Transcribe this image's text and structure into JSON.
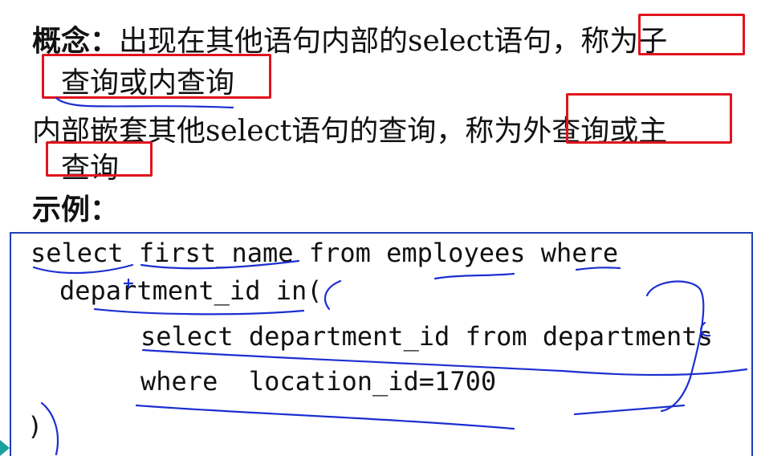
{
  "slide": {
    "concept_label": "概念：",
    "concept_text_a": "出现在其他语句内部的select语句，",
    "concept_text_b": "称为子",
    "concept_line2": "查询或内查询",
    "outer_text_a": "内部嵌套其他select语句的查询，称为",
    "outer_text_b": "外查询或主",
    "outer_line2": "查询",
    "example_label": "示例："
  },
  "code": {
    "line1": "select first_name from employees where",
    "line2": "department_id in(",
    "line3": "select department_id from departments",
    "line4": "where  location_id=1700",
    "line5": ")"
  },
  "colors": {
    "highlight_box": "#e0141e",
    "code_border": "#1f3fb8",
    "ink": "#1c2fd0"
  }
}
